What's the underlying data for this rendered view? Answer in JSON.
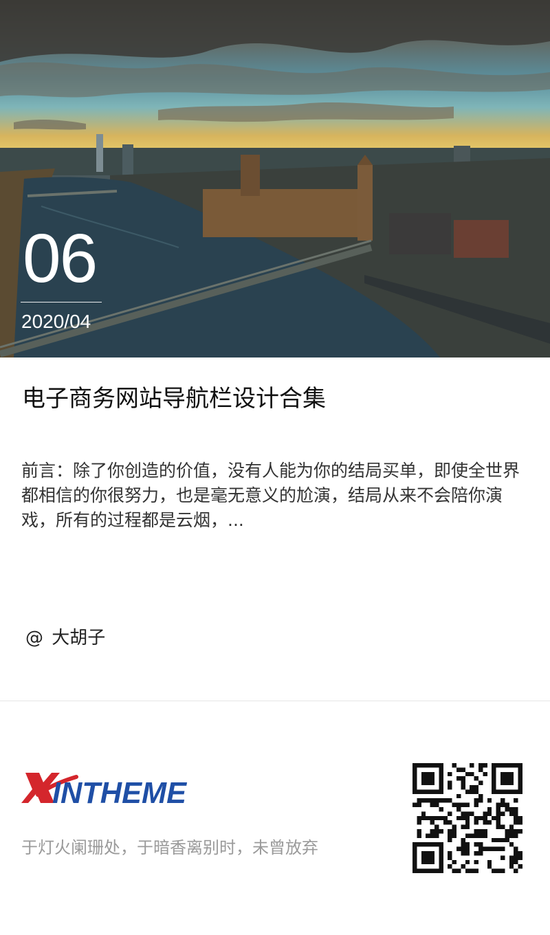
{
  "hero": {
    "date_day": "06",
    "date_month": "2020/04"
  },
  "article": {
    "title": "电子商务网站导航栏设计合集",
    "excerpt": "前言：除了你创造的价值，没有人能为你的结局买单，即使全世界都相信的你很努力，也是毫无意义的尬演，结局从来不会陪你演戏，所有的过程都是云烟，...",
    "author_prefix": "@",
    "author": "大胡子"
  },
  "footer": {
    "logo_text": "XINTHEME",
    "logo_colors": {
      "accent": "#d4262c",
      "primary": "#1f4fa6"
    },
    "tagline": "于灯火阑珊处，于暗香离别时，未曾放弃",
    "qr_icon": "qr-code-icon"
  }
}
